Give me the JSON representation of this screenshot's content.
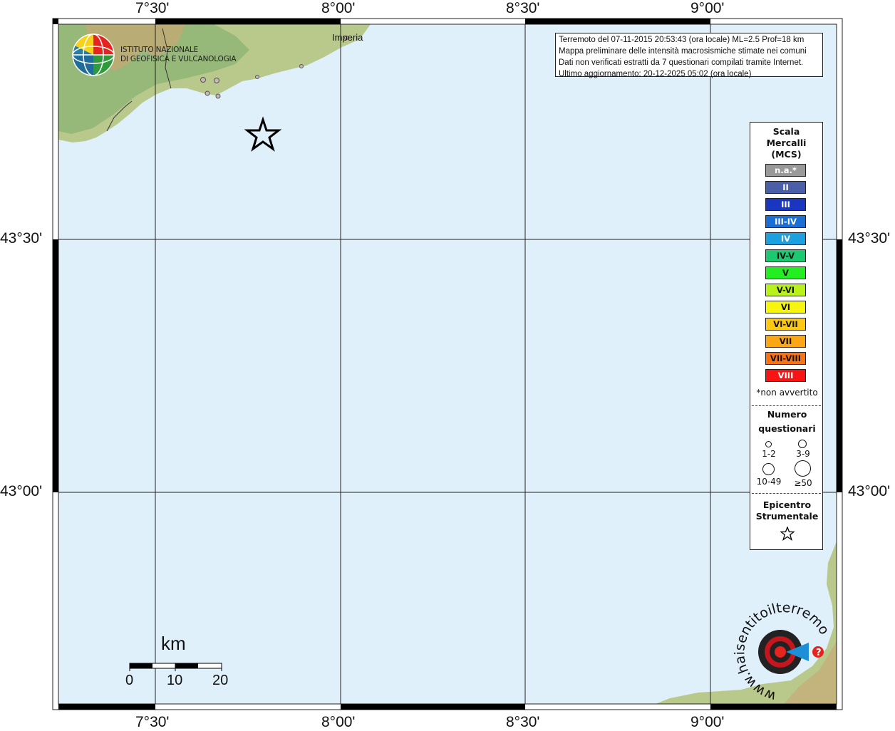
{
  "map": {
    "city_label": "Imperia",
    "lon_ticks_top": [
      "7°30'",
      "8°00'",
      "8°30'",
      "9°00'"
    ],
    "lon_ticks_bottom": [
      "7°30'",
      "8°00'",
      "8°30'",
      "9°00'"
    ],
    "lat_ticks_left": [
      "43°30'",
      "43°00'"
    ],
    "lat_ticks_right": [
      "43°30'",
      "43°00'"
    ],
    "sea_color": "#e0f0fb",
    "land_color": "#b8c98a"
  },
  "logo": {
    "line1": "ISTITUTO NAZIONALE",
    "line2": "DI GEOFISICA E VULCANOLOGIA"
  },
  "info_box": {
    "line1": "Terremoto del 07-11-2015 20:53:43 (ora locale) ML=2.5 Prof=18 km",
    "line2": "Mappa preliminare delle intensità macrosismiche stimate nei comuni",
    "line3": "Dati non verificati estratti da 7 questionari compilati tramite Internet.",
    "line4": "Ultimo aggiornamento: 20-12-2025 05:02 (ora locale)"
  },
  "legend": {
    "title1": "Scala",
    "title2": "Mercalli",
    "title3": "(MCS)",
    "scale": [
      {
        "label": "n.a.*",
        "color": "#999999",
        "text_color": "#ffffff"
      },
      {
        "label": "II",
        "color": "#4a5fa8",
        "text_color": "#ffffff"
      },
      {
        "label": "III",
        "color": "#1a36c0",
        "text_color": "#ffffff"
      },
      {
        "label": "III-IV",
        "color": "#1a6fd6",
        "text_color": "#ffffff"
      },
      {
        "label": "IV",
        "color": "#1ca0e0",
        "text_color": "#ffffff"
      },
      {
        "label": "IV-V",
        "color": "#1cc870",
        "text_color": "#111111"
      },
      {
        "label": "V",
        "color": "#22ee22",
        "text_color": "#111111"
      },
      {
        "label": "V-VI",
        "color": "#b8f21a",
        "text_color": "#111111"
      },
      {
        "label": "VI",
        "color": "#f5f510",
        "text_color": "#111111"
      },
      {
        "label": "VI-VII",
        "color": "#fbc814",
        "text_color": "#111111"
      },
      {
        "label": "VII",
        "color": "#fba614",
        "text_color": "#111111"
      },
      {
        "label": "VII-VIII",
        "color": "#f97214",
        "text_color": "#111111"
      },
      {
        "label": "VIII",
        "color": "#f91414",
        "text_color": "#ffffff"
      }
    ],
    "note": "*non avvertito",
    "count_title1": "Numero",
    "count_title2": "questionari",
    "counts": [
      "1-2",
      "3-9",
      "10-49",
      "≥50"
    ],
    "epi_title1": "Epicentro",
    "epi_title2": "Strumentale"
  },
  "scale_bar": {
    "unit": "km",
    "labels": [
      "0",
      "10",
      "20"
    ]
  },
  "watermark": {
    "text": "haisentitoilterremoto.it?",
    "url_text": "www."
  }
}
